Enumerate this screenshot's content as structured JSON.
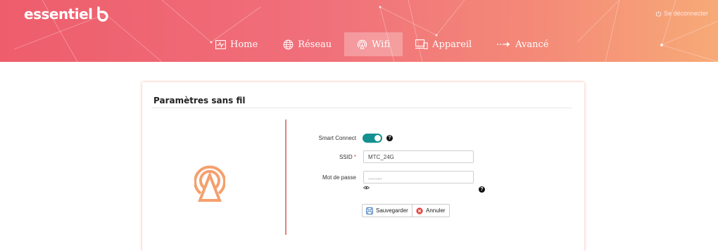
{
  "header": {
    "logo_text": "essentiel",
    "logout_label": "Se déconnecter",
    "nav": [
      {
        "label": "Home",
        "icon": "activity-icon"
      },
      {
        "label": "Réseau",
        "icon": "globe-icon"
      },
      {
        "label": "Wifi",
        "icon": "wifi-icon",
        "active": true
      },
      {
        "label": "Appareil",
        "icon": "devices-icon"
      },
      {
        "label": "Avancé",
        "icon": "arrow-right-icon"
      }
    ]
  },
  "card": {
    "title": "Paramètres sans fil",
    "smart_connect": {
      "label": "Smart Connect",
      "enabled": true
    },
    "ssid": {
      "label": "SSID",
      "required_marker": "*",
      "value": "MTC_24G"
    },
    "password": {
      "label": "Mot de passe",
      "value": "........."
    },
    "buttons": {
      "save": "Sauvegarder",
      "cancel": "Annuler"
    }
  },
  "colors": {
    "accent_teal": "#13908f",
    "brand_orange": "#f5a06e",
    "header_start": "#ee5d6c",
    "header_end": "#f7aa77",
    "cancel_red": "#e4433f"
  }
}
